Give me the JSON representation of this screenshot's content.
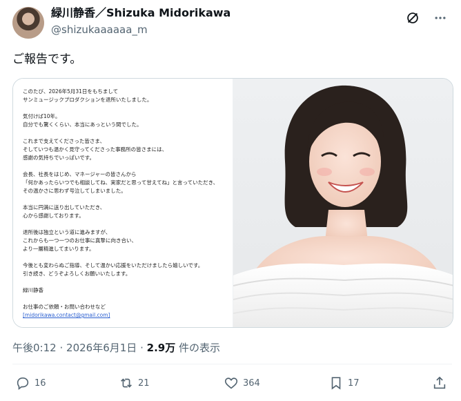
{
  "author": {
    "display_name": "緑川静香／Shizuka Midorikawa",
    "handle": "@shizukaaaaaa_m"
  },
  "header_icons": [
    "grok-icon",
    "more-icon"
  ],
  "tweet": {
    "text": "ご報告です。"
  },
  "document": {
    "paragraphs": [
      [
        "このたび、2026年5月31日をもちまして",
        "サンミュージックプロダクションを退所いたしました。"
      ],
      [
        "気付けば10年。",
        "自分でも驚くくらい、本当にあっという間でした。"
      ],
      [
        "これまで支えてくださった皆さま、",
        "そしていつも温かく見守ってくださった事務所の皆さまには、",
        "感謝の気持ちでいっぱいです。"
      ],
      [
        "会長、社長をはじめ、マネージャーの皆さんから",
        "「何かあったらいつでも相談してね、実家だと思って甘えてね」と言っていただき、",
        "その温かさに思わず号泣してしまいました。"
      ],
      [
        "本当に円満に送り出していただき、",
        "心から感謝しております。"
      ],
      [
        "退所後は独立という道に進みますが、",
        "これからも一つ一つのお仕事に真摯に向き合い、",
        "より一層精進してまいります。"
      ],
      [
        "今後とも変わらぬご指導、そして温かい応援をいただけましたら嬉しいです。",
        "引き続き、どうぞよろしくお願いいたします。"
      ],
      [
        "緑川静香"
      ]
    ],
    "contact_label": "お仕事のご依頼・お問い合わせなど",
    "contact_email": "[midorikawa.contact@gmail.com]"
  },
  "meta": {
    "time": "午後0:12",
    "sep1": "·",
    "date": "2026年6月1日",
    "sep2": "·",
    "views_count": "2.9万",
    "views_label": "件の表示"
  },
  "actions": {
    "replies": "16",
    "reposts": "21",
    "likes": "364",
    "bookmarks": "17"
  },
  "colors": {
    "text": "#0f1419",
    "secondary": "#536471",
    "border": "#cfd9de",
    "link": "#2a5fd0"
  }
}
